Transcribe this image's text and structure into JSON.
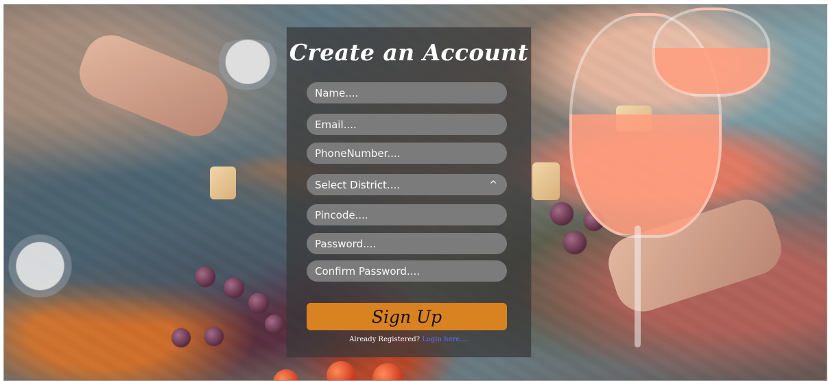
{
  "form": {
    "title": "Create an Account",
    "fields": {
      "name": "Name....",
      "email": "Email....",
      "phone": "PhoneNumber....",
      "pincode": "Pincode....",
      "password": "Password....",
      "confirm_password": "Confirm Password...."
    },
    "district": {
      "selected": "Select District....",
      "icon": "chevron-up-icon",
      "glyph": "^"
    },
    "submit_label": "Sign Up",
    "login_prompt": "Already Registered?",
    "login_link": "Login here...."
  },
  "colors": {
    "panel": "#373737",
    "input": "#808080",
    "button": "#d98222",
    "link": "#5f70ff"
  }
}
